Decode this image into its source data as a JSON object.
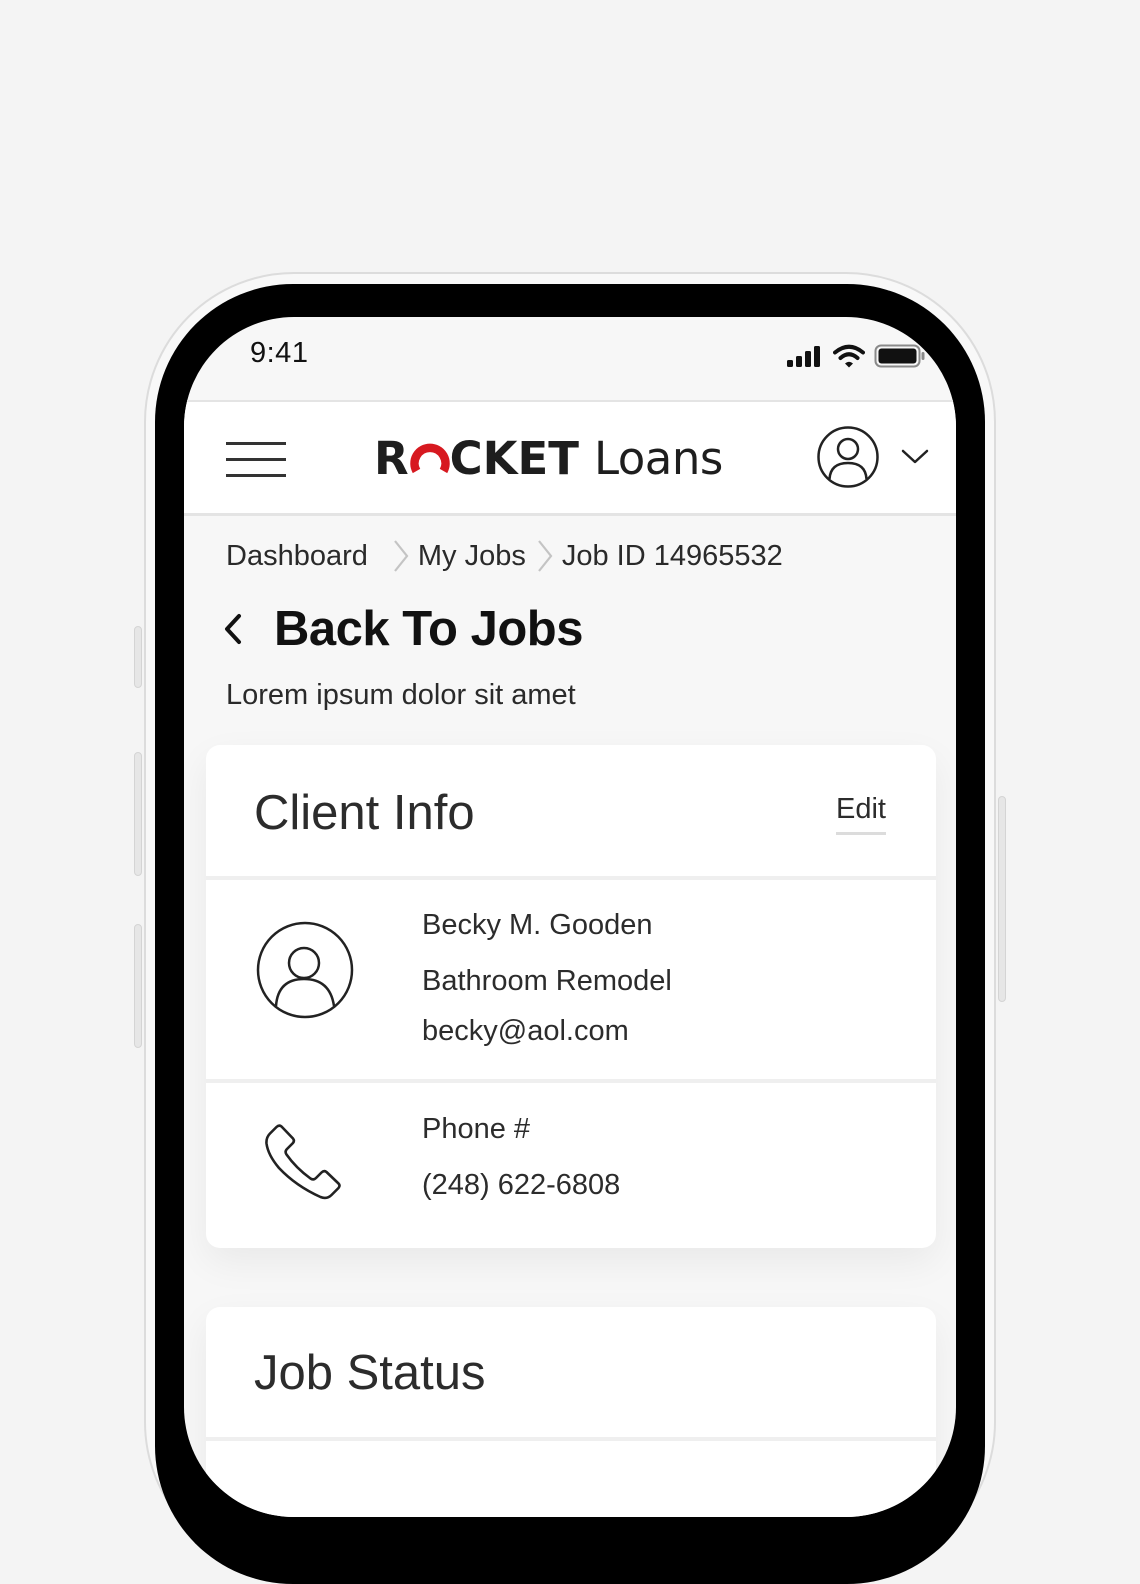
{
  "status_bar": {
    "time": "9:41"
  },
  "header": {
    "brand_rocket_r": "R",
    "brand_rocket_rest": "CKET",
    "brand_loans": "Loans",
    "accent_color": "#d71920"
  },
  "breadcrumb": {
    "items": [
      "Dashboard",
      "My Jobs",
      "Job ID 14965532"
    ]
  },
  "page": {
    "back_label": "Back To Jobs",
    "subtitle": "Lorem ipsum dolor sit amet"
  },
  "client_info": {
    "title": "Client Info",
    "edit_label": "Edit",
    "name": "Becky M. Gooden",
    "project": "Bathroom Remodel",
    "email": "becky@aol.com",
    "phone_label": "Phone #",
    "phone": "(248) 622-6808"
  },
  "job_status": {
    "title": "Job Status"
  }
}
